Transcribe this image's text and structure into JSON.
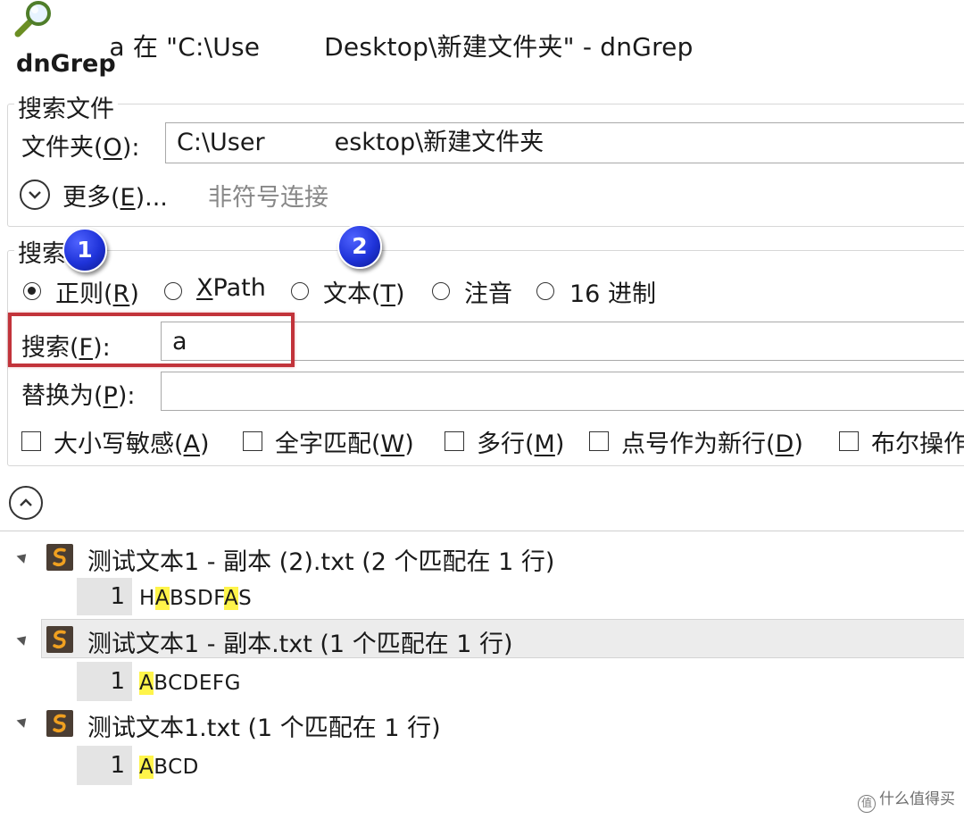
{
  "window": {
    "title_left": "a 在 \"C:\\Use",
    "title_right": "Desktop\\新建文件夹\" - dnGrep",
    "app_name": "dnGrep",
    "icon": "magnifier-icon"
  },
  "search_files": {
    "group_title": "搜索文件",
    "folder_label_pre": "文件夹(",
    "folder_label_key": "O",
    "folder_label_post": "):",
    "folder_value_left": "C:\\User",
    "folder_value_right": "esktop\\新建文件夹",
    "more_label_pre": "更多(",
    "more_label_key": "E",
    "more_label_post": ")...",
    "more_hint": "非符号连接"
  },
  "search": {
    "group_title": "搜索",
    "badge1": "1",
    "badge2": "2",
    "modes": [
      {
        "pre": "正则(",
        "key": "R",
        "post": ")",
        "checked": true
      },
      {
        "pre": "",
        "key": "X",
        "post": "Path",
        "checked": false
      },
      {
        "pre": "文本(",
        "key": "T",
        "post": ")",
        "checked": false
      },
      {
        "pre": "注音",
        "key": "",
        "post": "",
        "checked": false
      },
      {
        "pre": "16 进制",
        "key": "",
        "post": "",
        "checked": false
      }
    ],
    "search_label_pre": "搜索(",
    "search_label_key": "F",
    "search_label_post": "):",
    "search_value": "a",
    "replace_label_pre": "替换为(",
    "replace_label_key": "P",
    "replace_label_post": "):",
    "replace_value": "",
    "options": [
      {
        "pre": "大小写敏感(",
        "key": "A",
        "post": ")"
      },
      {
        "pre": "全字匹配(",
        "key": "W",
        "post": ")"
      },
      {
        "pre": "多行(",
        "key": "M",
        "post": ")"
      },
      {
        "pre": "点号作为新行(",
        "key": "D",
        "post": ")"
      },
      {
        "pre": "布尔操作",
        "key": "",
        "post": ""
      }
    ]
  },
  "results": [
    {
      "file": "测试文本1 - 副本 (2).txt (2 个匹配在 1 行)",
      "line_no": "1",
      "segments": [
        [
          "H",
          false
        ],
        [
          "A",
          true
        ],
        [
          "BSDF",
          false
        ],
        [
          "A",
          true
        ],
        [
          "S",
          false
        ]
      ]
    },
    {
      "file": "测试文本1 - 副本.txt (1 个匹配在 1 行)",
      "line_no": "1",
      "segments": [
        [
          "A",
          true
        ],
        [
          "BCDEFG",
          false
        ]
      ]
    },
    {
      "file": "测试文本1.txt (1 个匹配在 1 行)",
      "line_no": "1",
      "segments": [
        [
          "A",
          true
        ],
        [
          "BCD",
          false
        ]
      ]
    }
  ],
  "watermark": "什么值得买",
  "colors": {
    "highlight_border": "#c2333a",
    "match_highlight": "#fff44a",
    "badge": "#1f33d9"
  }
}
